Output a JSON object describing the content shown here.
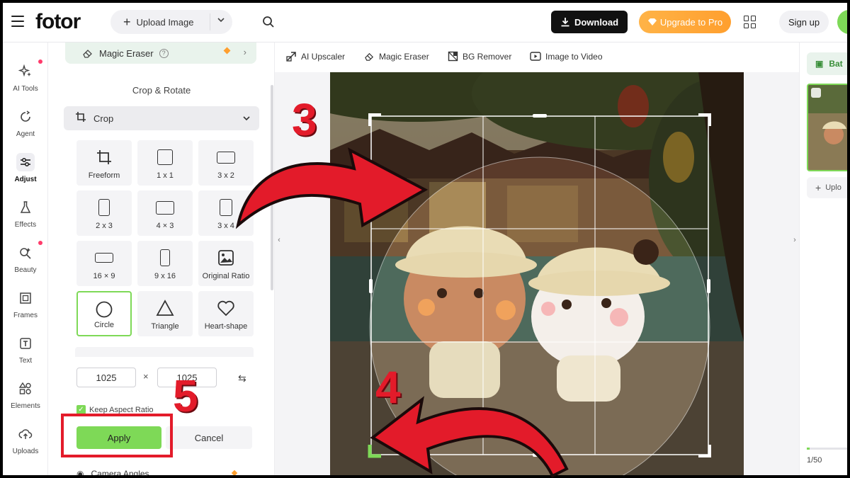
{
  "topbar": {
    "logo": "fotor",
    "upload_label": "Upload Image",
    "download_label": "Download",
    "upgrade_label": "Upgrade to Pro",
    "signup_label": "Sign up"
  },
  "rail": {
    "items": [
      {
        "label": "AI Tools",
        "icon": "sparkle-icon",
        "dot": true
      },
      {
        "label": "Agent",
        "icon": "agent-icon",
        "dot": false
      },
      {
        "label": "Adjust",
        "icon": "sliders-icon",
        "dot": false,
        "active": true
      },
      {
        "label": "Effects",
        "icon": "flask-icon",
        "dot": false
      },
      {
        "label": "Beauty",
        "icon": "beauty-icon",
        "dot": true
      },
      {
        "label": "Frames",
        "icon": "frame-icon",
        "dot": false
      },
      {
        "label": "Text",
        "icon": "text-icon",
        "dot": false
      },
      {
        "label": "Elements",
        "icon": "shapes-icon",
        "dot": false
      },
      {
        "label": "Uploads",
        "icon": "cloud-upload-icon",
        "dot": false
      }
    ]
  },
  "panel": {
    "magic_eraser_label": "Magic Eraser",
    "section_title": "Crop & Rotate",
    "crop_dropdown_label": "Crop",
    "tiles": [
      {
        "label": "Freeform",
        "shape": "freeform"
      },
      {
        "label": "1 x 1",
        "shape": "square"
      },
      {
        "label": "3 x 2",
        "shape": "landscape-3-2"
      },
      {
        "label": "2 x 3",
        "shape": "portrait-2-3"
      },
      {
        "label": "4 × 3",
        "shape": "landscape-4-3"
      },
      {
        "label": "3 x 4",
        "shape": "portrait-3-4"
      },
      {
        "label": "16 × 9",
        "shape": "landscape-16-9"
      },
      {
        "label": "9 x 16",
        "shape": "portrait-9-16"
      },
      {
        "label": "Original Ratio",
        "shape": "image"
      },
      {
        "label": "Circle",
        "shape": "circle",
        "selected": true
      },
      {
        "label": "Triangle",
        "shape": "triangle"
      },
      {
        "label": "Heart-shape",
        "shape": "heart"
      }
    ],
    "width_value": "1025",
    "height_value": "1025",
    "times": "×",
    "keep_aspect_label": "Keep Aspect Ratio",
    "apply_label": "Apply",
    "cancel_label": "Cancel",
    "camera_angles_label": "Camera Angles"
  },
  "toolbar": {
    "tools": [
      {
        "label": "AI Upscaler",
        "icon": "upscale-icon"
      },
      {
        "label": "Magic Eraser",
        "icon": "eraser-icon"
      },
      {
        "label": "BG Remover",
        "icon": "bg-remover-icon"
      },
      {
        "label": "Image to Video",
        "icon": "video-icon"
      }
    ]
  },
  "right_panel": {
    "batch_label": "Bat",
    "upload_label": "Uplo",
    "page_count": "1/50"
  },
  "annotations": {
    "step3": "3",
    "step4": "4",
    "step5": "5"
  },
  "colors": {
    "accent_green": "#7ed957",
    "annotation_red": "#e31b2a",
    "upgrade_orange": "#ff9f2e"
  }
}
